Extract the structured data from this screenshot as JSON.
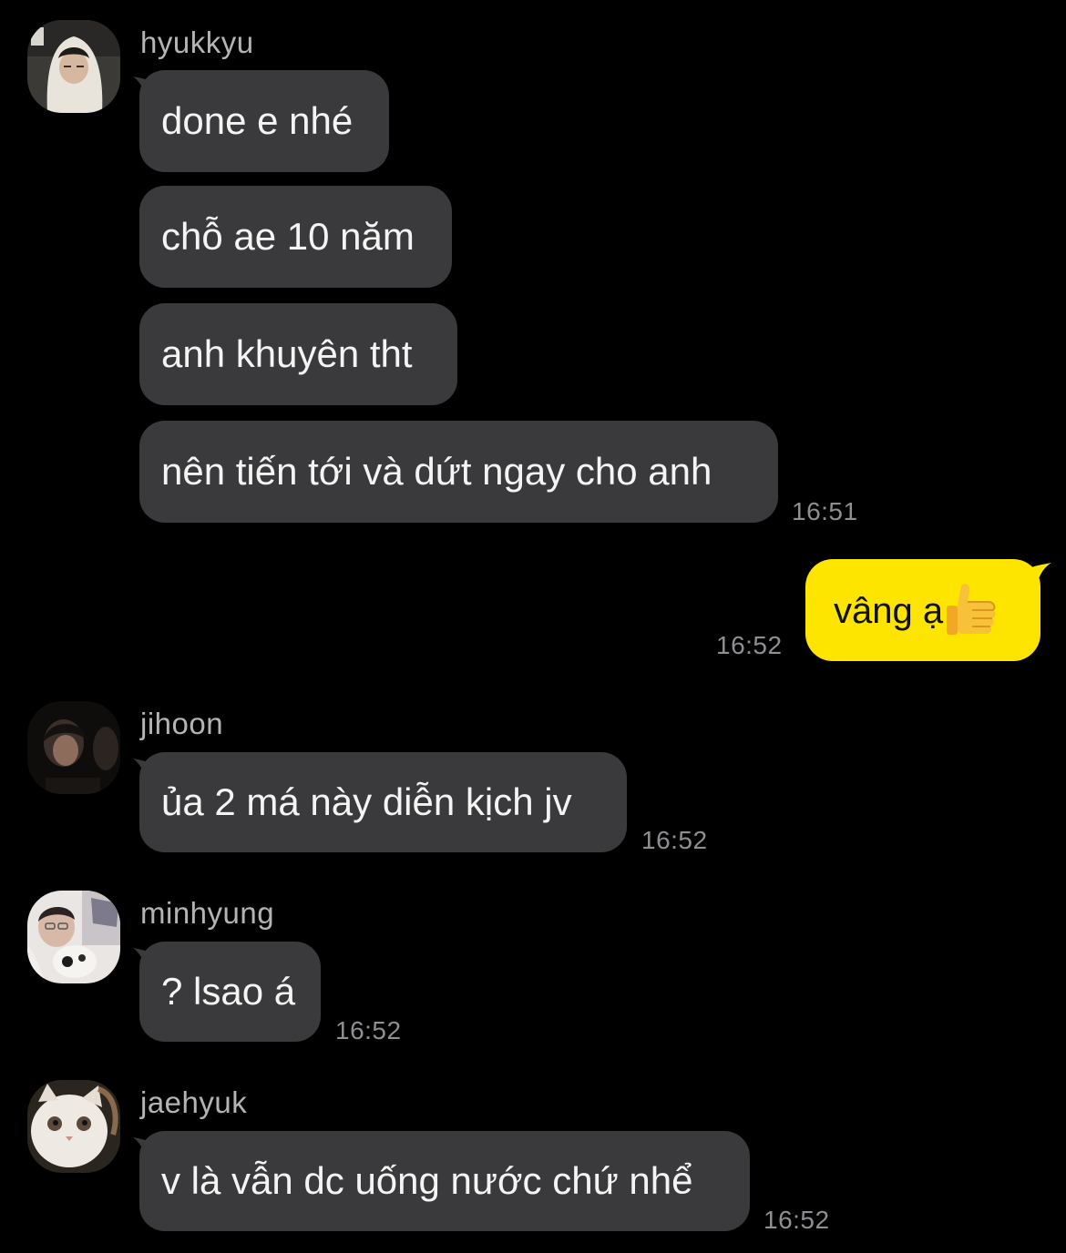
{
  "theme": {
    "background": "#000000",
    "incoming_bubble": "#3a3a3c",
    "outgoing_bubble": "#fee500",
    "timestamp_color": "#8e8e93",
    "name_color": "#b4b4b4"
  },
  "messages": [
    {
      "sender": "hyukkyu",
      "avatar_icon": "profile-photo",
      "bubbles": [
        "done e nhé",
        "chỗ ae 10 năm",
        "anh khuyên tht",
        "nên tiến tới và dứt ngay cho anh"
      ],
      "time": "16:51"
    },
    {
      "sender": "me",
      "bubbles": [
        "vâng ạ"
      ],
      "emoji_icon": "thumbs-up-emoji",
      "time": "16:52"
    },
    {
      "sender": "jihoon",
      "avatar_icon": "profile-photo",
      "bubbles": [
        "ủa 2 má này diễn kịch jv"
      ],
      "time": "16:52"
    },
    {
      "sender": "minhyung",
      "avatar_icon": "profile-photo",
      "bubbles": [
        "? lsao á"
      ],
      "time": "16:52"
    },
    {
      "sender": "jaehyuk",
      "avatar_icon": "cat-photo",
      "bubbles": [
        "v là vẫn dc uống nước chứ nhể"
      ],
      "time": "16:52"
    }
  ]
}
